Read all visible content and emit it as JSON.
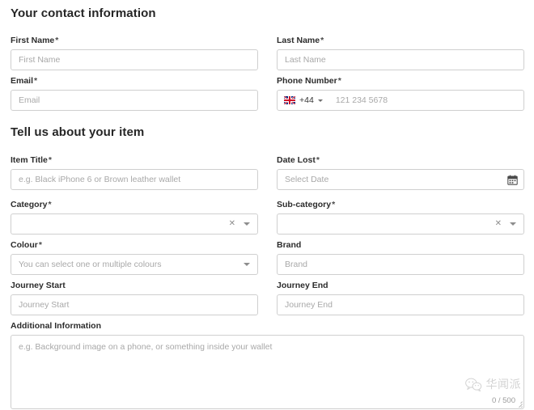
{
  "sections": {
    "contact": {
      "heading": "Your contact information"
    },
    "item": {
      "heading": "Tell us about your item"
    }
  },
  "required_marker": "*",
  "fields": {
    "first_name": {
      "label": "First Name",
      "required": true,
      "placeholder": "First Name",
      "value": ""
    },
    "last_name": {
      "label": "Last Name",
      "required": true,
      "placeholder": "Last Name",
      "value": ""
    },
    "email": {
      "label": "Email",
      "required": true,
      "placeholder": "Email",
      "value": ""
    },
    "phone": {
      "label": "Phone Number",
      "required": true,
      "placeholder": "121 234 5678",
      "value": "",
      "country_flag": "uk-flag-icon",
      "dial_code": "+44"
    },
    "item_title": {
      "label": "Item Title",
      "required": true,
      "placeholder": "e.g. Black iPhone 6 or Brown leather wallet",
      "value": ""
    },
    "date_lost": {
      "label": "Date Lost",
      "required": true,
      "placeholder": "Select Date",
      "value": "",
      "icon": "calendar-icon"
    },
    "category": {
      "label": "Category",
      "required": true,
      "placeholder": "",
      "value": "",
      "icons": [
        "clear-icon",
        "chevron-down-icon"
      ]
    },
    "sub_category": {
      "label": "Sub-category",
      "required": true,
      "placeholder": "",
      "value": "",
      "icons": [
        "clear-icon",
        "chevron-down-icon"
      ]
    },
    "colour": {
      "label": "Colour",
      "required": true,
      "placeholder": "You can select one or multiple colours",
      "value": "",
      "icons": [
        "chevron-down-icon"
      ]
    },
    "brand": {
      "label": "Brand",
      "required": false,
      "placeholder": "Brand",
      "value": ""
    },
    "journey_start": {
      "label": "Journey Start",
      "required": false,
      "placeholder": "Journey Start",
      "value": ""
    },
    "journey_end": {
      "label": "Journey End",
      "required": false,
      "placeholder": "Journey End",
      "value": ""
    },
    "additional_information": {
      "label": "Additional Information",
      "required": false,
      "placeholder": "e.g. Background image on a phone, or something inside your wallet",
      "value": "",
      "counter": "0 / 500"
    }
  },
  "watermark": {
    "text": "华闻派",
    "icon": "wechat-icon"
  },
  "colors": {
    "border": "#cfcfcf",
    "placeholder_text": "#a8a8a8",
    "label_text": "#2c2c2c",
    "heading_text": "#262626",
    "background": "#ffffff",
    "flag_blue": "#00247d",
    "flag_red": "#cf142b"
  }
}
